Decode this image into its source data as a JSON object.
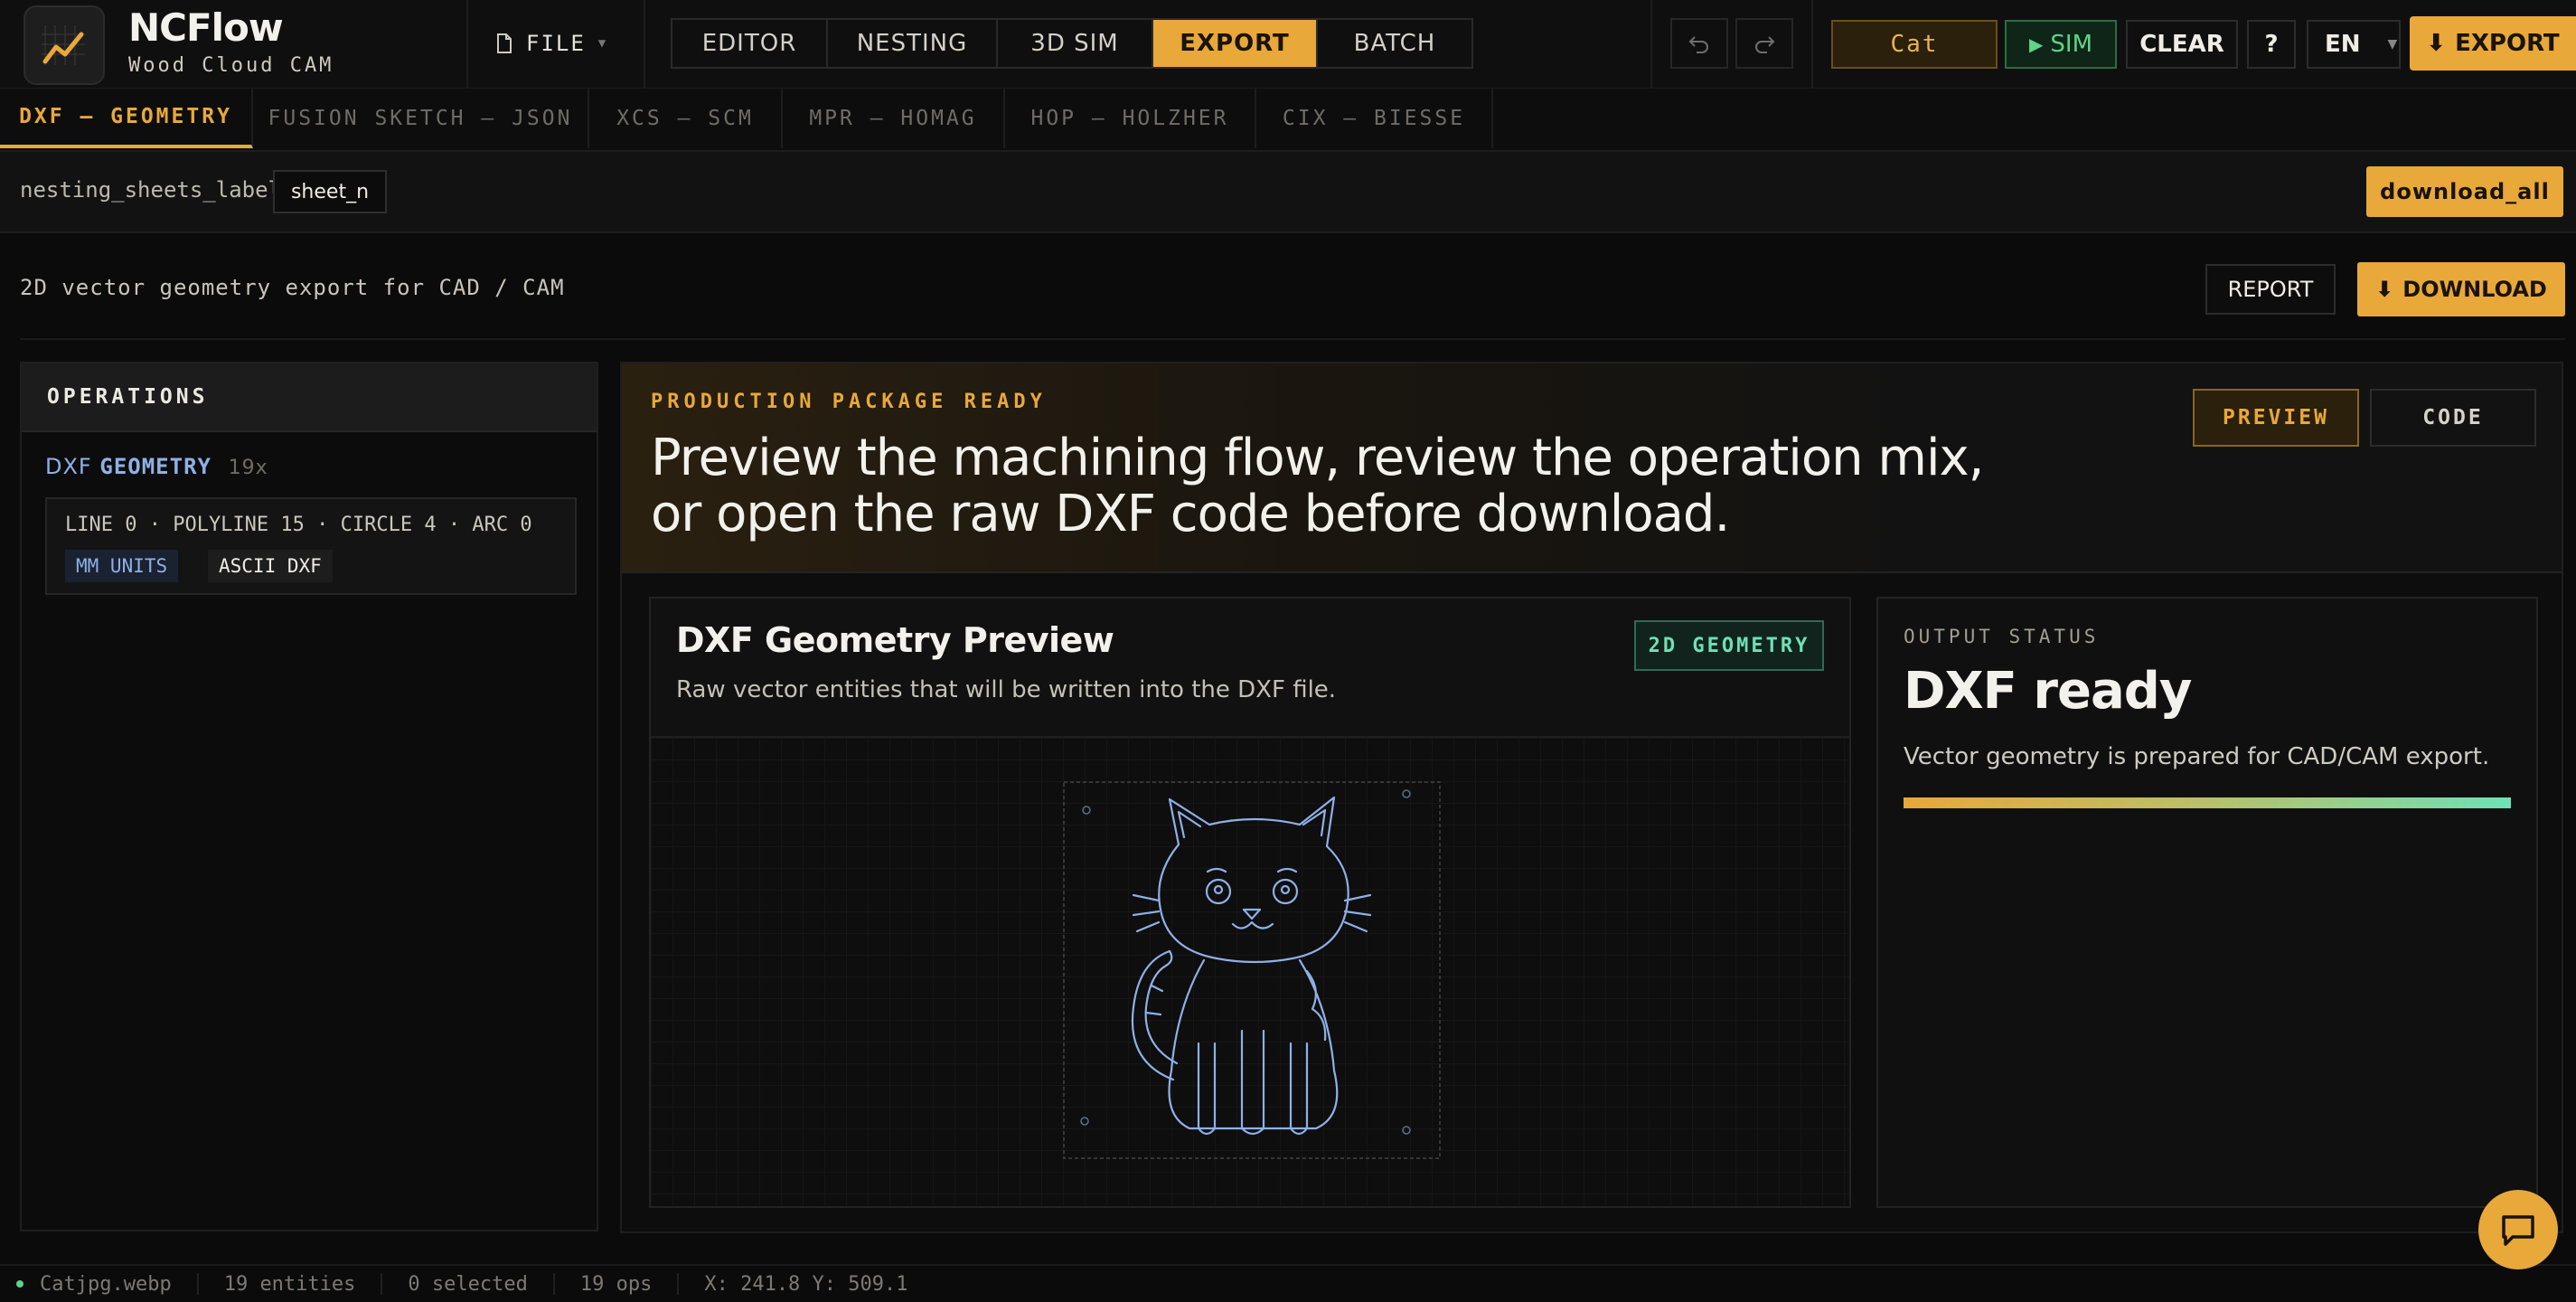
{
  "app": {
    "name": "NCFlow",
    "subtitle": "Wood Cloud CAM"
  },
  "toolbar": {
    "file_label": "FILE",
    "mode_tabs": [
      "EDITOR",
      "NESTING",
      "3D SIM",
      "EXPORT",
      "BATCH"
    ],
    "active_mode": "EXPORT",
    "project_name": "Cat",
    "sim_label": "SIM",
    "clear_label": "CLEAR",
    "help_label": "?",
    "language": "EN",
    "export_label": "EXPORT"
  },
  "format_tabs": [
    "DXF — GEOMETRY",
    "FUSION SKETCH — JSON",
    "XCS — SCM",
    "MPR — HOMAG",
    "HOP — HOLZHER",
    "CIX — BIESSE"
  ],
  "nesting": {
    "label": "nesting_sheets_label",
    "sheet_chip": "sheet_n",
    "download_all_label": "download_all"
  },
  "export_header": {
    "description": "2D vector geometry export for CAD / CAM",
    "report_label": "REPORT",
    "download_label": "DOWNLOAD"
  },
  "operations": {
    "title": "OPERATIONS",
    "items": [
      {
        "name_prefix": "DXF",
        "name_rest": "GEOMETRY",
        "count": "19x",
        "stats": "LINE 0 · POLYLINE 15 · CIRCLE 4 · ARC 0",
        "chips": [
          "MM UNITS",
          "ASCII DXF"
        ]
      }
    ]
  },
  "banner": {
    "kicker": "PRODUCTION PACKAGE READY",
    "headline": "Preview the machining flow, review the operation mix, or open the raw DXF code before download.",
    "preview_label": "PREVIEW",
    "code_label": "CODE"
  },
  "preview_card": {
    "title": "DXF Geometry Preview",
    "subtitle": "Raw vector entities that will be written into the DXF file.",
    "badge": "2D GEOMETRY"
  },
  "status_card": {
    "kicker": "OUTPUT STATUS",
    "title": "DXF ready",
    "text": "Vector geometry is prepared for CAD/CAM export.",
    "progress": 1.0
  },
  "statusbar": {
    "file": "Catjpg.webp",
    "entities": "19 entities",
    "selected": "0 selected",
    "ops": "19 ops",
    "coords": "X: 241.8 Y: 509.1"
  },
  "colors": {
    "accent": "#e8a83a",
    "success": "#5fd38a",
    "geometry": "#8fb0e6",
    "badge": "#6fe0b6"
  },
  "icons": {
    "logo": "chart-trend-icon",
    "file": "document-icon",
    "undo": "undo-icon",
    "redo": "redo-icon",
    "sim": "play-icon",
    "download": "download-arrow-icon",
    "chat": "chat-bubble-icon"
  }
}
